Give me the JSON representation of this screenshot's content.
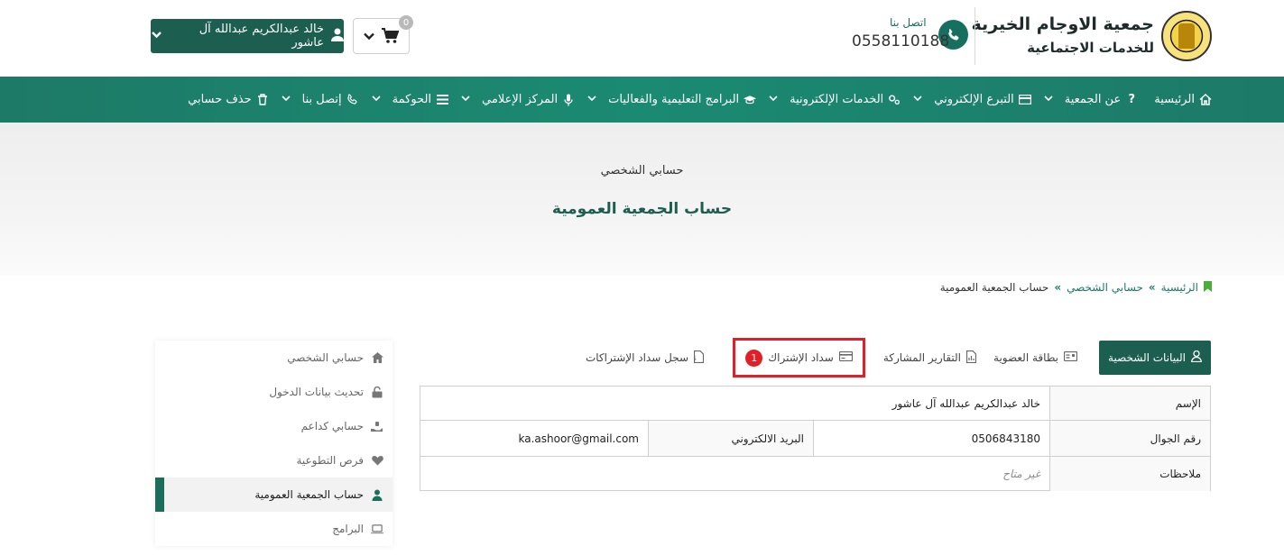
{
  "header": {
    "org_name": "جمعية الاوجام الخيرية",
    "org_sub": "للخدمات الاجتماعية",
    "contact_label": "اتصل بنا",
    "contact_number": "0558110188",
    "cart_count": "0",
    "user_name": "خالد عبدالكريم عبدالله آل عاشور"
  },
  "nav": {
    "items": [
      {
        "label": "الرئيسية",
        "icon": "home-icon"
      },
      {
        "label": "عن الجمعية",
        "icon": "question-icon"
      },
      {
        "label": "التبرع الإلكتروني",
        "icon": "card-icon"
      },
      {
        "label": "الخدمات الإلكترونية",
        "icon": "gears-icon"
      },
      {
        "label": "البرامج التعليمية والفعاليات",
        "icon": "graduation-cap-icon"
      },
      {
        "label": "المركز الإعلامي",
        "icon": "microphone-icon"
      },
      {
        "label": "الحوكمة",
        "icon": "list-icon"
      },
      {
        "label": "إتصل بنا",
        "icon": "phone-icon"
      },
      {
        "label": "حذف حسابي",
        "icon": "trash-icon"
      }
    ]
  },
  "hero": {
    "subtitle": "حسابي الشخصي",
    "title": "حساب الجمعية العمومية"
  },
  "breadcrumb": {
    "home": "الرئيسية",
    "sep": "»",
    "account": "حسابي الشخصي",
    "current": "حساب الجمعية العمومية"
  },
  "tabs": [
    {
      "label": "البيانات الشخصية",
      "icon": "user-icon"
    },
    {
      "label": "بطاقة العضوية",
      "icon": "id-card-icon"
    },
    {
      "label": "التقارير المشاركة",
      "icon": "file-chart-icon"
    },
    {
      "label": "سداد الإشتراك",
      "icon": "credit-card-icon",
      "badge": "1"
    },
    {
      "label": "سجل سداد الإشتراكات",
      "icon": "file-invoice-icon"
    }
  ],
  "table": {
    "name_label": "الإسم",
    "name_value": "خالد عبدالكريم عبدالله آل عاشور",
    "mobile_label": "رقم الجوال",
    "mobile_value": "0506843180",
    "email_label": "البريد الالكتروني",
    "email_value": "ka.ashoor@gmail.com",
    "notes_label": "ملاحظات",
    "notes_value": "غير متاح"
  },
  "sidemenu": {
    "items": [
      {
        "label": "حسابي الشخصي",
        "icon": "home-icon"
      },
      {
        "label": "تحديث بيانات الدخول",
        "icon": "unlock-icon"
      },
      {
        "label": "حسابي كداعم",
        "icon": "hand-holding-icon"
      },
      {
        "label": "فرص التطوعية",
        "icon": "heart-icon"
      },
      {
        "label": "حساب الجمعية العمومية",
        "icon": "user-tie-icon"
      },
      {
        "label": "البرامج",
        "icon": "laptop-icon"
      }
    ]
  },
  "colors": {
    "primary": "#1c5e4f",
    "nav": "#1b8a72",
    "highlight": "#e01f26"
  }
}
